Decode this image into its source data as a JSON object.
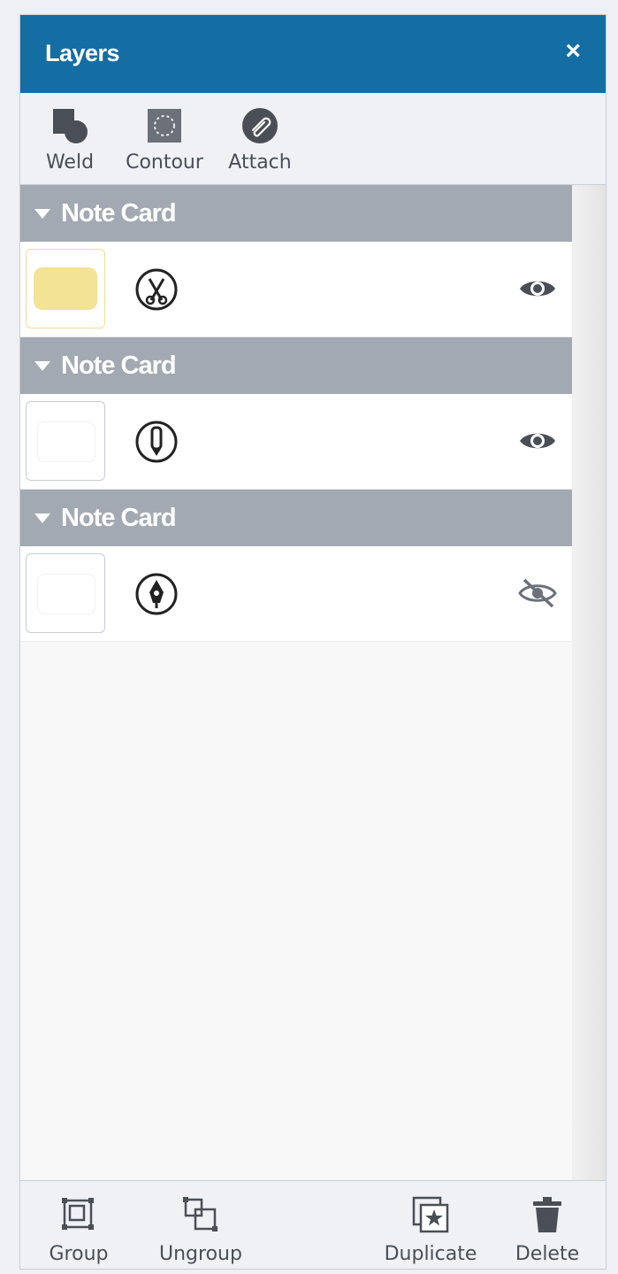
{
  "panel": {
    "title": "Layers",
    "close_glyph": "×"
  },
  "toolbar": {
    "items": [
      {
        "label": "Weld",
        "icon": "weld-icon"
      },
      {
        "label": "Contour",
        "icon": "contour-icon"
      },
      {
        "label": "Attach",
        "icon": "attach-icon"
      }
    ]
  },
  "groups": [
    {
      "name": "Note Card",
      "layer": {
        "fill": "#f2e395",
        "operation": "cut",
        "visible": true,
        "selected": true
      }
    },
    {
      "name": "Note Card",
      "layer": {
        "fill": "#ffffff",
        "operation": "draw",
        "visible": true,
        "selected": false
      }
    },
    {
      "name": "Note Card",
      "layer": {
        "fill": "#ffffff",
        "operation": "write",
        "visible": false,
        "selected": false
      }
    }
  ],
  "footer": {
    "items": [
      {
        "label": "Group",
        "icon": "group-icon"
      },
      {
        "label": "Ungroup",
        "icon": "ungroup-icon"
      },
      {
        "label": "Duplicate",
        "icon": "duplicate-icon"
      },
      {
        "label": "Delete",
        "icon": "trash-icon"
      }
    ]
  },
  "colors": {
    "header": "#146ea3",
    "group_header": "#a3a9b3",
    "icon": "#4a4f57"
  }
}
